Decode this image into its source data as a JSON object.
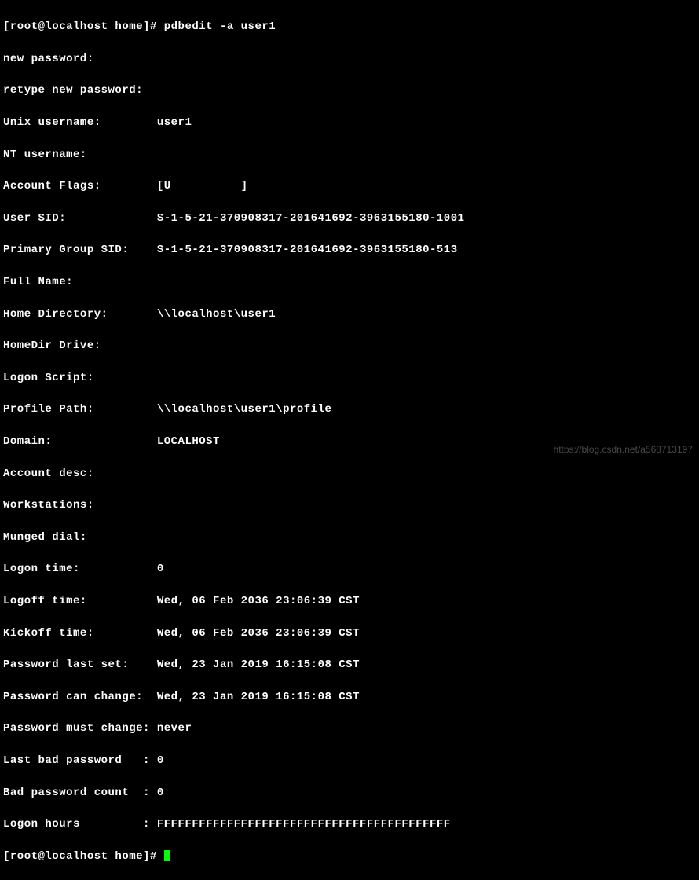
{
  "prompt1": "[root@localhost home]# ",
  "command1": "pdbedit -a user1",
  "lines": {
    "new_password": "new password:",
    "retype_password": "retype new password:",
    "unix_username_label": "Unix username:        ",
    "unix_username_value": "user1",
    "nt_username": "NT username:",
    "account_flags_label": "Account Flags:        ",
    "account_flags_value": "[U          ]",
    "user_sid_label": "User SID:             ",
    "user_sid_value": "S-1-5-21-370908317-201641692-3963155180-1001",
    "primary_group_sid_label": "Primary Group SID:    ",
    "primary_group_sid_value": "S-1-5-21-370908317-201641692-3963155180-513",
    "full_name": "Full Name:",
    "home_directory_label": "Home Directory:       ",
    "home_directory_value": "\\\\localhost\\user1",
    "homedir_drive": "HomeDir Drive:",
    "logon_script": "Logon Script:",
    "profile_path_label": "Profile Path:         ",
    "profile_path_value": "\\\\localhost\\user1\\profile",
    "domain_label": "Domain:               ",
    "domain_value": "LOCALHOST",
    "account_desc": "Account desc:",
    "workstations": "Workstations:",
    "munged_dial": "Munged dial:",
    "logon_time_label": "Logon time:           ",
    "logon_time_value": "0",
    "logoff_time_label": "Logoff time:          ",
    "logoff_time_value": "Wed, 06 Feb 2036 23:06:39 CST",
    "kickoff_time_label": "Kickoff time:         ",
    "kickoff_time_value": "Wed, 06 Feb 2036 23:06:39 CST",
    "password_last_set_label": "Password last set:    ",
    "password_last_set_value": "Wed, 23 Jan 2019 16:15:08 CST",
    "password_can_change_label": "Password can change:  ",
    "password_can_change_value": "Wed, 23 Jan 2019 16:15:08 CST",
    "password_must_change_label": "Password must change: ",
    "password_must_change_value": "never",
    "last_bad_password_label": "Last bad password   : ",
    "last_bad_password_value": "0",
    "bad_password_count_label": "Bad password count  : ",
    "bad_password_count_value": "0",
    "logon_hours_label": "Logon hours         : ",
    "logon_hours_value": "FFFFFFFFFFFFFFFFFFFFFFFFFFFFFFFFFFFFFFFFFF"
  },
  "prompt2": "[root@localhost home]# ",
  "watermark": "https://blog.csdn.net/a568713197"
}
